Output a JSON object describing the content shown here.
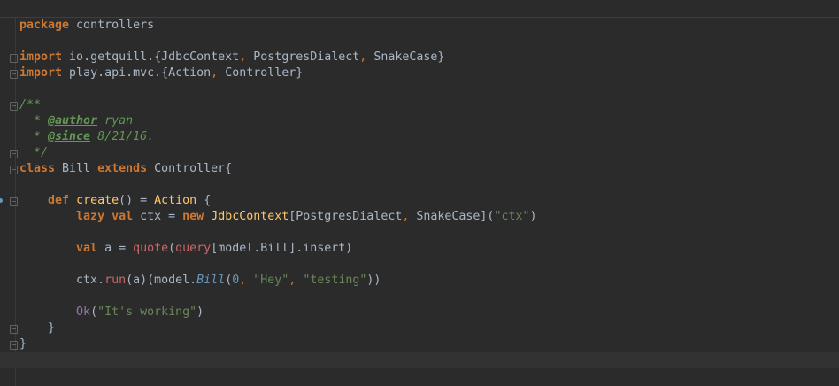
{
  "editor": {
    "lines": [
      [
        {
          "c": "kw",
          "t": "package"
        },
        {
          "c": "id",
          "t": " controllers"
        }
      ],
      [],
      [
        {
          "c": "kw",
          "t": "import"
        },
        {
          "c": "id",
          "t": " io.getquill.{JdbcContext"
        },
        {
          "c": "comma",
          "t": ","
        },
        {
          "c": "id",
          "t": " PostgresDialect"
        },
        {
          "c": "comma",
          "t": ","
        },
        {
          "c": "id",
          "t": " SnakeCase}"
        }
      ],
      [
        {
          "c": "kw",
          "t": "import"
        },
        {
          "c": "id",
          "t": " play.api.mvc.{Action"
        },
        {
          "c": "comma",
          "t": ","
        },
        {
          "c": "id",
          "t": " Controller}"
        }
      ],
      [],
      [
        {
          "c": "doc",
          "t": "/**"
        }
      ],
      [
        {
          "c": "doc",
          "t": "  * "
        },
        {
          "c": "tag",
          "t": "@author"
        },
        {
          "c": "doc",
          "t": " ryan"
        }
      ],
      [
        {
          "c": "doc",
          "t": "  * "
        },
        {
          "c": "tag",
          "t": "@since"
        },
        {
          "c": "doc",
          "t": " 8/21/16."
        }
      ],
      [
        {
          "c": "doc",
          "t": "  */"
        }
      ],
      [
        {
          "c": "kw",
          "t": "class"
        },
        {
          "c": "id",
          "t": " Bill "
        },
        {
          "c": "kw",
          "t": "extends"
        },
        {
          "c": "id",
          "t": " Controller{"
        }
      ],
      [],
      [
        {
          "c": "id",
          "t": "    "
        },
        {
          "c": "kw",
          "t": "def"
        },
        {
          "c": "id",
          "t": " "
        },
        {
          "c": "method",
          "t": "create"
        },
        {
          "c": "id",
          "t": "() = "
        },
        {
          "c": "type",
          "t": "Action"
        },
        {
          "c": "id",
          "t": " {"
        }
      ],
      [
        {
          "c": "id",
          "t": "        "
        },
        {
          "c": "kw",
          "t": "lazy val"
        },
        {
          "c": "id",
          "t": " ctx = "
        },
        {
          "c": "kw",
          "t": "new"
        },
        {
          "c": "id",
          "t": " "
        },
        {
          "c": "type",
          "t": "JdbcContext"
        },
        {
          "c": "id",
          "t": "[PostgresDialect"
        },
        {
          "c": "comma",
          "t": ","
        },
        {
          "c": "id",
          "t": " SnakeCase]("
        },
        {
          "c": "str",
          "t": "\"ctx\""
        },
        {
          "c": "id",
          "t": ")"
        }
      ],
      [],
      [
        {
          "c": "id",
          "t": "        "
        },
        {
          "c": "kw",
          "t": "val"
        },
        {
          "c": "id",
          "t": " a = "
        },
        {
          "c": "red",
          "t": "quote"
        },
        {
          "c": "id",
          "t": "("
        },
        {
          "c": "red",
          "t": "query"
        },
        {
          "c": "id",
          "t": "[model.Bill].insert)"
        }
      ],
      [],
      [
        {
          "c": "id",
          "t": "        ctx."
        },
        {
          "c": "red",
          "t": "run"
        },
        {
          "c": "id",
          "t": "(a)(model."
        },
        {
          "c": "ital",
          "t": "Bill"
        },
        {
          "c": "id",
          "t": "("
        },
        {
          "c": "num",
          "t": "0"
        },
        {
          "c": "comma",
          "t": ","
        },
        {
          "c": "id",
          "t": " "
        },
        {
          "c": "str",
          "t": "\"Hey\""
        },
        {
          "c": "comma",
          "t": ","
        },
        {
          "c": "id",
          "t": " "
        },
        {
          "c": "str",
          "t": "\"testing\""
        },
        {
          "c": "id",
          "t": "))"
        }
      ],
      [],
      [
        {
          "c": "id",
          "t": "        "
        },
        {
          "c": "obj",
          "t": "Ok"
        },
        {
          "c": "id",
          "t": "("
        },
        {
          "c": "str",
          "t": "\"It's working\""
        },
        {
          "c": "id",
          "t": ")"
        }
      ],
      [
        {
          "c": "id",
          "t": "    }"
        }
      ],
      [
        {
          "c": "id",
          "t": "}"
        }
      ],
      []
    ],
    "caret_line": 21
  }
}
